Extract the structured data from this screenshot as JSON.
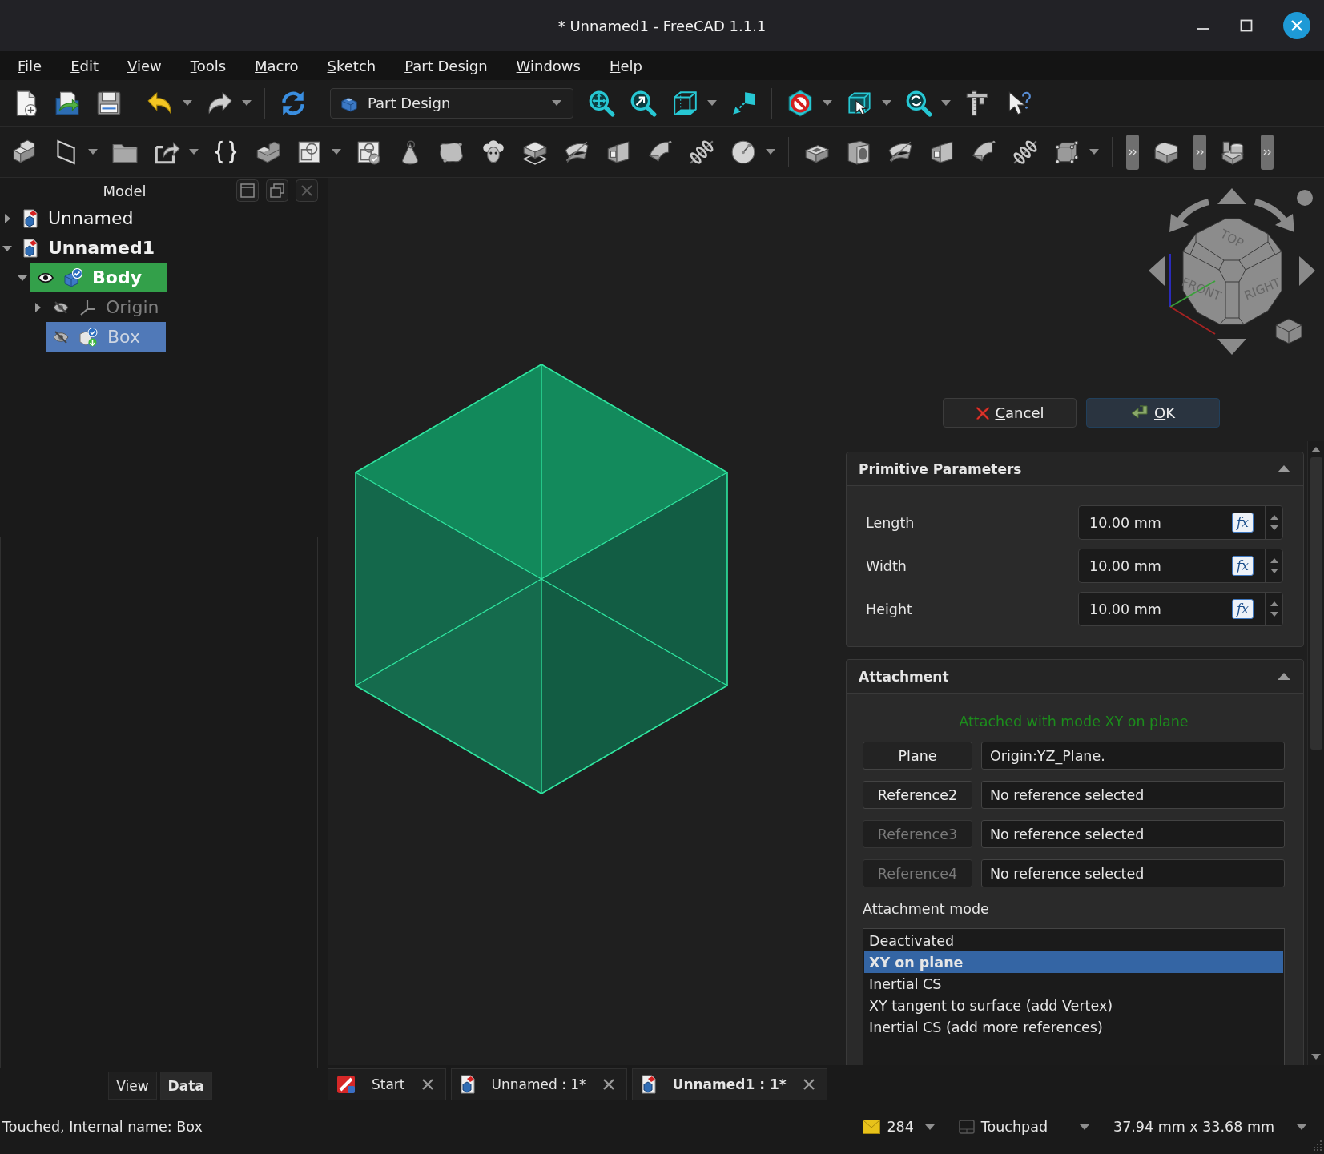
{
  "window": {
    "title": "* Unnamed1 - FreeCAD 1.1.1"
  },
  "menu_bar": [
    "File",
    "Edit",
    "View",
    "Tools",
    "Macro",
    "Sketch",
    "Part Design",
    "Windows",
    "Help"
  ],
  "toolbar": {
    "workbench": "Part Design"
  },
  "model_panel": {
    "title": "Model",
    "tree": [
      {
        "label": "Unnamed",
        "kind": "document",
        "expanded": false,
        "active": false,
        "selected": false
      },
      {
        "label": "Unnamed1",
        "kind": "document",
        "expanded": true,
        "active": true,
        "selected": false,
        "children": [
          {
            "label": "Body",
            "kind": "body",
            "expanded": true,
            "active": true,
            "selected": false,
            "visible": true,
            "children": [
              {
                "label": "Origin",
                "kind": "origin",
                "expanded": false,
                "active": false,
                "selected": false,
                "visible": false
              },
              {
                "label": "Box",
                "kind": "feature",
                "active": false,
                "selected": true,
                "visible": false
              }
            ]
          }
        ]
      }
    ]
  },
  "property_panel": {
    "tabs": [
      {
        "label": "View",
        "selected": false
      },
      {
        "label": "Data",
        "selected": true
      }
    ]
  },
  "view_3d": {
    "nav_cube": {
      "faces": [
        "TOP",
        "FRONT",
        "RIGHT"
      ]
    }
  },
  "task_panel": {
    "buttons": [
      {
        "label": "Cancel",
        "kind": "cancel",
        "default": false
      },
      {
        "label": "OK",
        "kind": "ok",
        "default": true
      }
    ],
    "primitive_parameters": {
      "title": "Primitive Parameters",
      "fields": [
        {
          "label": "Length",
          "value": "10.00 mm",
          "expression_button": "fx"
        },
        {
          "label": "Width",
          "value": "10.00 mm",
          "expression_button": "fx"
        },
        {
          "label": "Height",
          "value": "10.00 mm",
          "expression_button": "fx"
        }
      ]
    },
    "attachment": {
      "title": "Attachment",
      "status": "Attached with mode XY on plane",
      "references": [
        {
          "label": "Plane",
          "value": "Origin:YZ_Plane.",
          "disabled": false
        },
        {
          "label": "Reference2",
          "value": "No reference selected",
          "disabled": false
        },
        {
          "label": "Reference3",
          "value": "No reference selected",
          "disabled": true
        },
        {
          "label": "Reference4",
          "value": "No reference selected",
          "disabled": true
        }
      ],
      "mode_label": "Attachment mode",
      "modes": [
        {
          "label": "Deactivated",
          "selected": false
        },
        {
          "label": "XY on plane",
          "selected": true
        },
        {
          "label": "Inertial CS",
          "selected": false
        },
        {
          "label": "XY tangent to surface (add Vertex)",
          "selected": false
        },
        {
          "label": "Inertial CS (add more references)",
          "selected": false
        }
      ]
    }
  },
  "doc_tabs": [
    {
      "label": "Start",
      "kind": "start",
      "selected": false
    },
    {
      "label": "Unnamed : 1*",
      "kind": "document",
      "selected": false
    },
    {
      "label": "Unnamed1 : 1*",
      "kind": "document",
      "selected": true
    }
  ],
  "status_bar": {
    "message": "Touched, Internal name: Box",
    "notifications": "284",
    "navigation": "Touchpad",
    "dimensions": "37.94 mm x 33.68 mm"
  }
}
